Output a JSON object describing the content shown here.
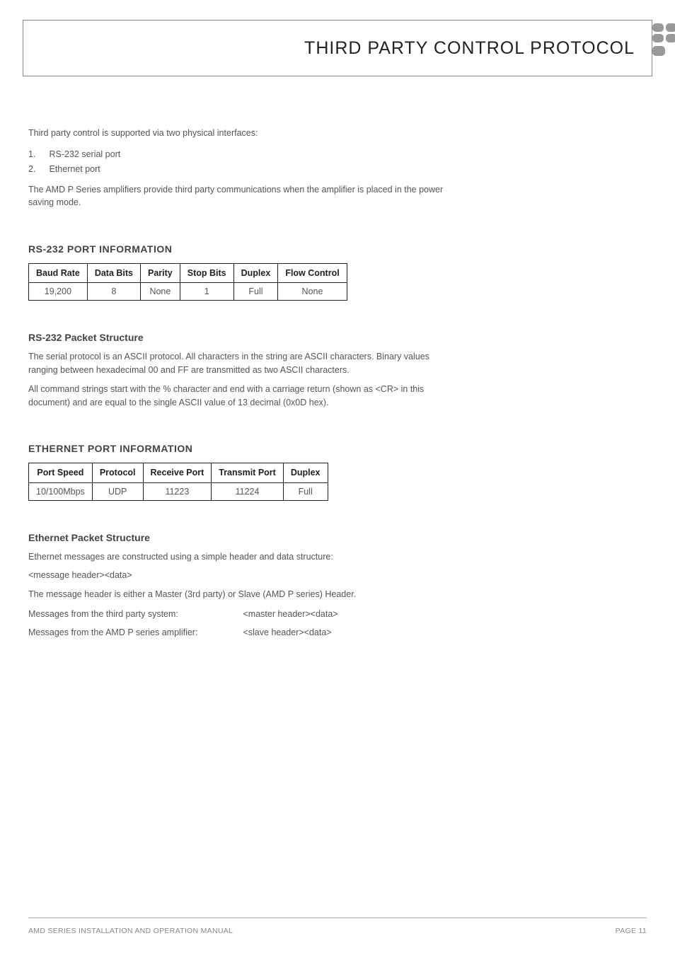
{
  "header": {
    "title": "THIRD PARTY CONTROL PROTOCOL"
  },
  "intro": "Third party control is supported via two physical interfaces:",
  "list": {
    "item1_num": "1.",
    "item1": "RS-232 serial port",
    "item2_num": "2.",
    "item2": "Ethernet port"
  },
  "intro_para": "The AMD P Series amplifiers provide third party communications when the amplifier is placed in the power saving mode.",
  "rs232": {
    "heading": "RS-232 PORT INFORMATION",
    "th": {
      "baud": "Baud Rate",
      "data": "Data Bits",
      "parity": "Parity",
      "stop": "Stop Bits",
      "duplex": "Duplex",
      "flow": "Flow Control"
    },
    "row": {
      "baud": "19,200",
      "data": "8",
      "parity": "None",
      "stop": "1",
      "duplex": "Full",
      "flow": "None"
    },
    "sub_heading": "RS-232 Packet Structure",
    "para1": "The serial protocol is an ASCII protocol. All characters in the string are ASCII characters. Binary values ranging between hexadecimal 00 and FF are transmitted as two ASCII characters.",
    "para2": "All command strings start with the % character and end with a carriage return (shown as <CR> in this document) and are equal to the single ASCII value of 13 decimal (0x0D hex)."
  },
  "ethernet": {
    "heading": "ETHERNET PORT INFORMATION",
    "th": {
      "speed": "Port Speed",
      "protocol": "Protocol",
      "receive": "Receive Port",
      "transmit": "Transmit Port",
      "duplex": "Duplex"
    },
    "row": {
      "speed": "10/100Mbps",
      "protocol": "UDP",
      "receive": "11223",
      "transmit": "11224",
      "duplex": "Full"
    },
    "sub_heading": "Ethernet Packet Structure",
    "para1": "Ethernet messages are constructed using a simple header and data structure:",
    "para2": "<message header><data>",
    "para3": "The message header is either a Master (3rd party) or Slave (AMD P series) Header.",
    "msg1_label": "Messages from the third party system:",
    "msg1_val": "<master header><data>",
    "msg2_label": "Messages from the AMD P series amplifier:",
    "msg2_val": "<slave header><data>"
  },
  "footer": {
    "left": "AMD SERIES INSTALLATION AND OPERATION MANUAL",
    "right": "PAGE 11"
  }
}
